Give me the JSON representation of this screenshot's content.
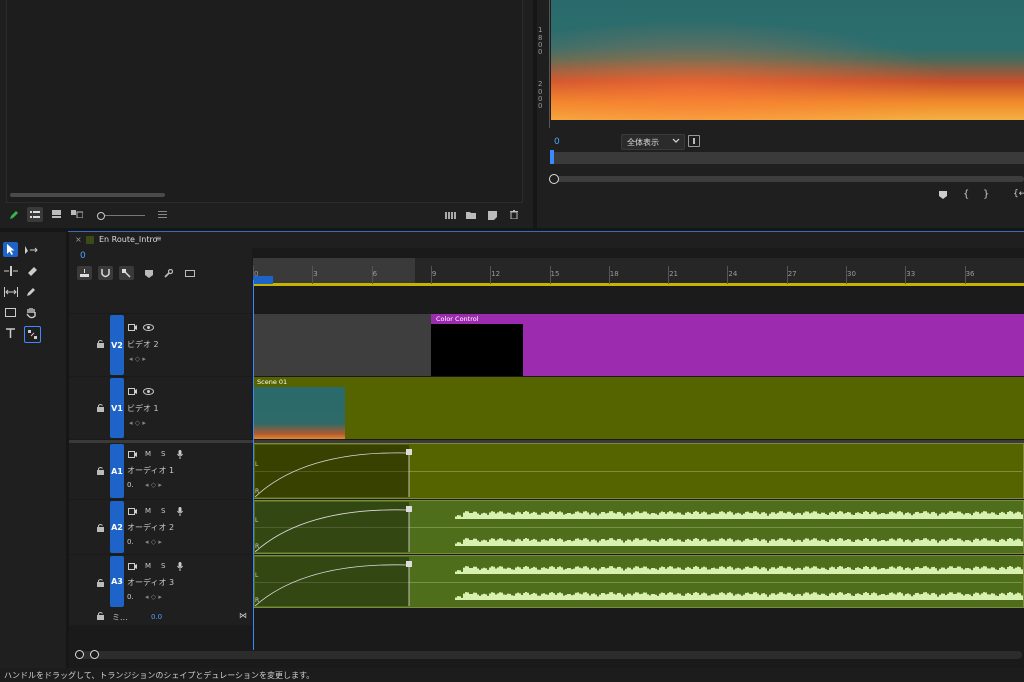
{
  "program_monitor": {
    "timecode": "0",
    "zoom_select": "全体表示",
    "vertical_ruler_marks": [
      "1",
      "8",
      "0",
      "0",
      "2",
      "0",
      "0",
      "0"
    ]
  },
  "project_panel": {},
  "timeline": {
    "tab_title": "En Route_Intro",
    "playhead_timecode": "0",
    "ruler_ticks": [
      "0",
      "3",
      "6",
      "9",
      "12",
      "15",
      "18",
      "21",
      "24",
      "27",
      "30",
      "33",
      "36"
    ],
    "tracks": [
      {
        "id": "V2",
        "name": "ビデオ 2"
      },
      {
        "id": "V1",
        "name": "ビデオ 1"
      },
      {
        "id": "A1",
        "name": "オーディオ 1",
        "m": "M",
        "s": "S",
        "vol": "0."
      },
      {
        "id": "A2",
        "name": "オーディオ 2",
        "m": "M",
        "s": "S",
        "vol": "0."
      },
      {
        "id": "A3",
        "name": "オーディオ 3",
        "m": "M",
        "s": "S",
        "vol": "0."
      }
    ],
    "mix": {
      "label": "ミ...",
      "value": "0.0"
    },
    "clips": {
      "color_control": "Color Control",
      "scene": "Scene 01",
      "audio_markers": [
        "L",
        "R"
      ]
    },
    "colors": {
      "video_purple": "#9d2bb0",
      "video_olive": "#566400",
      "audio_green": "#4e6e1c",
      "badge_blue": "#1e64c8"
    }
  },
  "status_bar": {
    "text": "ハンドルをドラッグして、トランジションのシェイプとデュレーションを変更します。"
  }
}
